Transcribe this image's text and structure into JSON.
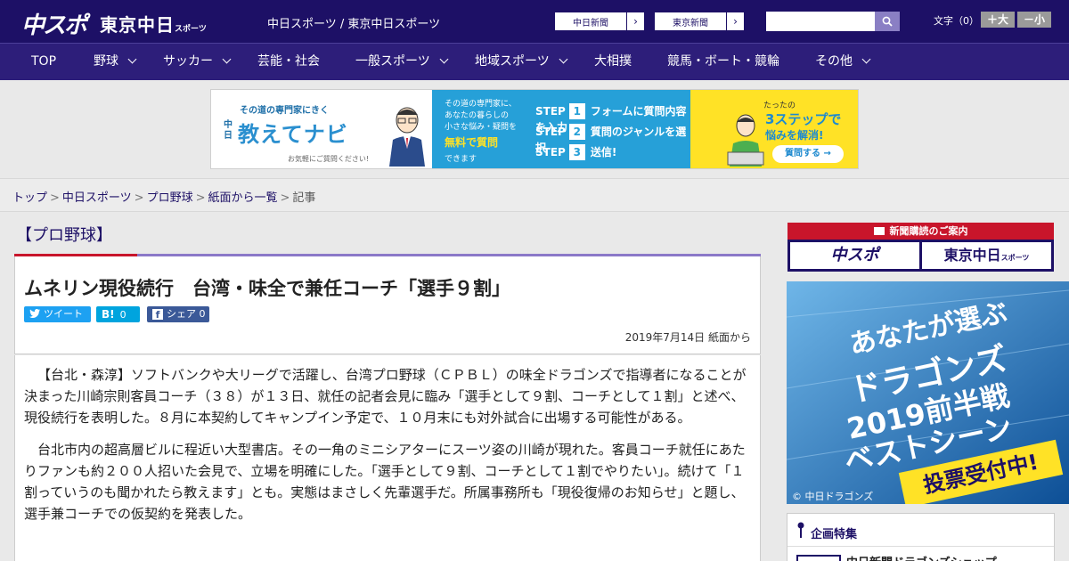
{
  "header": {
    "logo_main": "中スポ",
    "logo_tokyo": "東京中日",
    "logo_tokyo_small": "スポーツ",
    "tagline": "中日スポーツ / 東京中日スポーツ",
    "site_links": [
      {
        "label": "中日新聞"
      },
      {
        "label": "東京新聞"
      }
    ],
    "search_placeholder": "",
    "font_size_label": "文字（0）",
    "font_up": "＋大",
    "font_down": "－小"
  },
  "nav": {
    "items": [
      {
        "label": "TOP",
        "dropdown": false
      },
      {
        "label": "野球",
        "dropdown": true
      },
      {
        "label": "サッカー",
        "dropdown": true
      },
      {
        "label": "芸能・社会",
        "dropdown": false
      },
      {
        "label": "一般スポーツ",
        "dropdown": true
      },
      {
        "label": "地域スポーツ",
        "dropdown": true
      },
      {
        "label": "大相撲",
        "dropdown": false
      },
      {
        "label": "競馬・ボート・競輪",
        "dropdown": false
      },
      {
        "label": "その他",
        "dropdown": true
      }
    ]
  },
  "banner": {
    "kicker": "その道の専門家にきく",
    "brand_small": "中日",
    "title": "教えてナビ",
    "note": "お気軽にご質問ください!",
    "desc_line1": "その道の専門家に、",
    "desc_line2": "あなたの暮らしの",
    "desc_line3": "小さな悩み・疑問を",
    "free": "無料で質問",
    "desc_end": "できます",
    "steps": [
      {
        "label": "STEP",
        "num": "1",
        "text": "フォームに質問内容を入力"
      },
      {
        "label": "STEP",
        "num": "2",
        "text": "質問のジャンルを選択"
      },
      {
        "label": "STEP",
        "num": "3",
        "text": "送信!"
      }
    ],
    "right_kicker": "たったの",
    "right_title": "3ステップで",
    "right_sub": "悩みを解消!",
    "ask_button": "質問する →"
  },
  "breadcrumb": {
    "items": [
      "トップ",
      "中日スポーツ",
      "プロ野球",
      "紙面から一覧"
    ],
    "current": "記事",
    "separator": ">"
  },
  "article": {
    "category": "【プロ野球】",
    "headline": "ムネリン現役続行　台湾・味全で兼任コーチ「選手９割」",
    "share": {
      "tweet": "ツイート",
      "hatena_count": "0",
      "facebook": "シェア",
      "facebook_count": "0"
    },
    "date": "2019年7月14日 紙面から",
    "paragraphs": [
      "【台北・森淳】ソフトバンクや大リーグで活躍し、台湾プロ野球（ＣＰＢＬ）の味全ドラゴンズで指導者になることが決まった川崎宗則客員コーチ（３８）が１３日、就任の記者会見に臨み「選手として９割、コーチとして１割」と述べ、現役続行を表明した。８月に本契約してキャンプイン予定で、１０月末にも対外試合に出場する可能性がある。",
      "台北市内の超高層ビルに程近い大型書店。その一角のミニシアターにスーツ姿の川崎が現れた。客員コーチ就任にあたりファンも約２００人招いた会見で、立場を明確にした。「選手として９割、コーチとして１割でやりたい」。続けて「１割っていうのも聞かれたら教えます」とも。実態はまさしく先輩選手だ。所属事務所も「現役復帰のお知らせ」と題し、選手兼コーチでの仮契約を発表した。"
    ]
  },
  "sidebar": {
    "subscription_head": "新聞購読のご案内",
    "sub_logo_1": "中スポ",
    "sub_logo_2": "東京中日",
    "sub_logo_2_small": "スポーツ",
    "promo_lines": [
      "あなたが選ぶ",
      "ドラゴンズ",
      "2019前半戦",
      "ベストシーン"
    ],
    "promo_vote": "投票受付中!",
    "promo_copy": "© 中日ドラゴンズ",
    "feature_title": "企画特集",
    "feature_item": "中日新聞ドラゴンズショップ"
  },
  "colors": {
    "header_bg": "#1d1066",
    "nav_bg": "#2d1e7a",
    "accent_red": "#c8152b",
    "accent_purple": "#8b78c8",
    "twitter": "#1da1f2",
    "hatena": "#00a4de",
    "facebook": "#3b5998"
  }
}
